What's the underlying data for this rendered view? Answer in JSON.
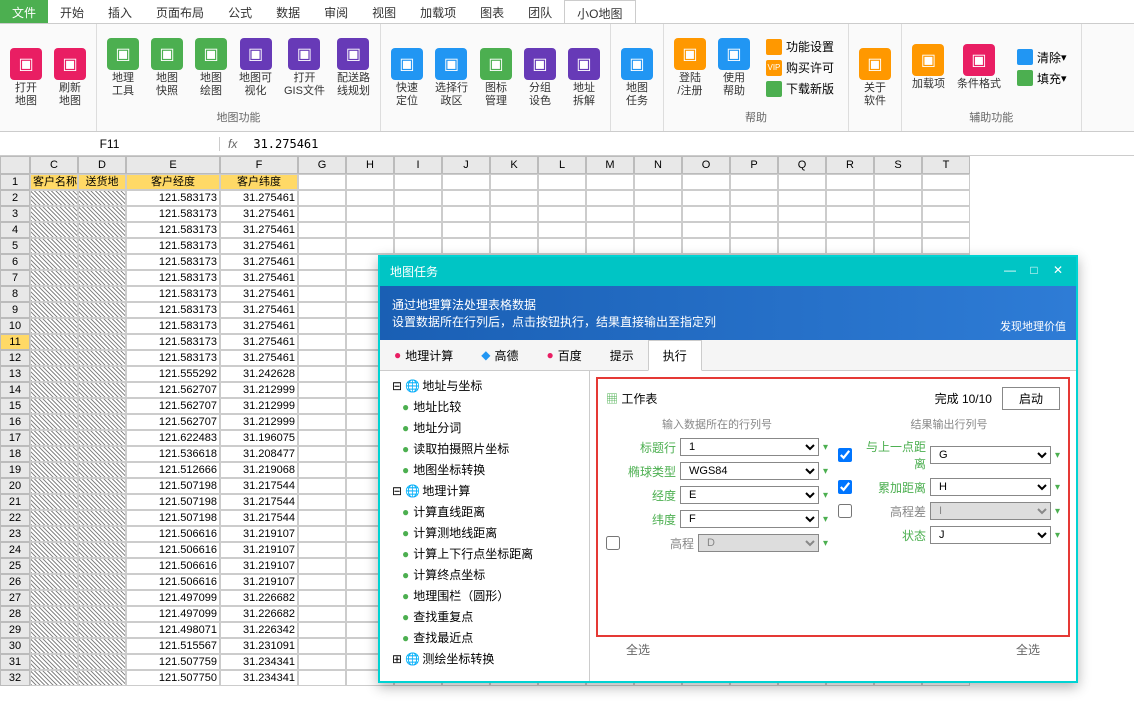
{
  "menu": {
    "file": "文件",
    "tabs": [
      "开始",
      "插入",
      "页面布局",
      "公式",
      "数据",
      "审阅",
      "视图",
      "加载项",
      "图表",
      "团队",
      "小O地图"
    ]
  },
  "ribbon": {
    "group1": {
      "buttons": [
        {
          "label": "打开\n地图",
          "color": "#e91e63"
        },
        {
          "label": "刷新\n地图",
          "color": "#e91e63"
        }
      ]
    },
    "group2": {
      "title": "地图功能",
      "buttons": [
        {
          "label": "地理\n工具",
          "color": "#4CAF50"
        },
        {
          "label": "地图\n快照",
          "color": "#4CAF50"
        },
        {
          "label": "地图\n绘图",
          "color": "#4CAF50"
        },
        {
          "label": "地图可\n视化",
          "color": "#673AB7"
        },
        {
          "label": "打开\nGIS文件",
          "color": "#673AB7"
        },
        {
          "label": "配送路\n线规划",
          "color": "#673AB7"
        }
      ]
    },
    "group3": {
      "buttons": [
        {
          "label": "快速\n定位",
          "color": "#2196F3"
        },
        {
          "label": "选择行\n政区",
          "color": "#2196F3"
        },
        {
          "label": "图标\n管理",
          "color": "#4CAF50"
        },
        {
          "label": "分组\n设色",
          "color": "#673AB7"
        },
        {
          "label": "地址\n拆解",
          "color": "#673AB7"
        }
      ]
    },
    "group4": {
      "buttons": [
        {
          "label": "地图\n任务",
          "color": "#2196F3"
        }
      ]
    },
    "group5": {
      "title": "帮助",
      "buttons": [
        {
          "label": "登陆\n/注册",
          "color": "#ff9800"
        },
        {
          "label": "使用\n帮助",
          "color": "#2196F3"
        }
      ],
      "small": [
        "功能设置",
        "购买许可",
        "下载新版"
      ]
    },
    "group6": {
      "buttons": [
        {
          "label": "关于\n软件",
          "color": "#ff9800"
        }
      ]
    },
    "group7": {
      "title": "辅助功能",
      "buttons": [
        {
          "label": "加载项",
          "color": "#ff9800"
        },
        {
          "label": "条件格式",
          "color": "#e91e63"
        }
      ],
      "small": [
        "清除",
        "填充"
      ]
    }
  },
  "formula": {
    "cell_ref": "F11",
    "fx": "fx",
    "value": "31.275461"
  },
  "sheet": {
    "cols": [
      "C",
      "D",
      "E",
      "F",
      "G",
      "H",
      "I",
      "J",
      "K",
      "L",
      "M",
      "N",
      "O",
      "P",
      "Q",
      "R",
      "S",
      "T"
    ],
    "headers": [
      "客户名称",
      "送货地",
      "客户经度",
      "客户纬度"
    ],
    "selected_row": 11,
    "rows": [
      {
        "n": 1,
        "e": "",
        "f": "",
        "hdr": true
      },
      {
        "n": 2,
        "e": "121.583173",
        "f": "31.275461"
      },
      {
        "n": 3,
        "e": "121.583173",
        "f": "31.275461"
      },
      {
        "n": 4,
        "e": "121.583173",
        "f": "31.275461"
      },
      {
        "n": 5,
        "e": "121.583173",
        "f": "31.275461"
      },
      {
        "n": 6,
        "e": "121.583173",
        "f": "31.275461"
      },
      {
        "n": 7,
        "e": "121.583173",
        "f": "31.275461"
      },
      {
        "n": 8,
        "e": "121.583173",
        "f": "31.275461"
      },
      {
        "n": 9,
        "e": "121.583173",
        "f": "31.275461"
      },
      {
        "n": 10,
        "e": "121.583173",
        "f": "31.275461"
      },
      {
        "n": 11,
        "e": "121.583173",
        "f": "31.275461"
      },
      {
        "n": 12,
        "e": "121.583173",
        "f": "31.275461"
      },
      {
        "n": 13,
        "e": "121.555292",
        "f": "31.242628"
      },
      {
        "n": 14,
        "e": "121.562707",
        "f": "31.212999"
      },
      {
        "n": 15,
        "e": "121.562707",
        "f": "31.212999"
      },
      {
        "n": 16,
        "e": "121.562707",
        "f": "31.212999"
      },
      {
        "n": 17,
        "e": "121.622483",
        "f": "31.196075"
      },
      {
        "n": 18,
        "e": "121.536618",
        "f": "31.208477"
      },
      {
        "n": 19,
        "e": "121.512666",
        "f": "31.219068"
      },
      {
        "n": 20,
        "e": "121.507198",
        "f": "31.217544"
      },
      {
        "n": 21,
        "e": "121.507198",
        "f": "31.217544"
      },
      {
        "n": 22,
        "e": "121.507198",
        "f": "31.217544"
      },
      {
        "n": 23,
        "e": "121.506616",
        "f": "31.219107"
      },
      {
        "n": 24,
        "e": "121.506616",
        "f": "31.219107"
      },
      {
        "n": 25,
        "e": "121.506616",
        "f": "31.219107"
      },
      {
        "n": 26,
        "e": "121.506616",
        "f": "31.219107"
      },
      {
        "n": 27,
        "e": "121.497099",
        "f": "31.226682"
      },
      {
        "n": 28,
        "e": "121.497099",
        "f": "31.226682"
      },
      {
        "n": 29,
        "e": "121.498071",
        "f": "31.226342"
      },
      {
        "n": 30,
        "e": "121.515567",
        "f": "31.231091"
      },
      {
        "n": 31,
        "e": "121.507759",
        "f": "31.234341"
      },
      {
        "n": 32,
        "e": "121.507750",
        "f": "31.234341"
      }
    ]
  },
  "dialog": {
    "title": "地图任务",
    "banner_l1": "通过地理算法处理表格数据",
    "banner_l2": "设置数据所在行列后，点击按钮执行，结果直接输出至指定列",
    "banner_tag": "发现地理价值",
    "tabs": [
      "地理计算",
      "高德",
      "百度",
      "提示",
      "执行"
    ],
    "active_tab": 4,
    "tree": {
      "n1": "地址与坐标",
      "n1c": [
        "地址比较",
        "地址分词",
        "读取拍摄照片坐标",
        "地图坐标转换"
      ],
      "n2": "地理计算",
      "n2c": [
        "计算直线距离",
        "计算测地线距离",
        "计算上下行点坐标距离",
        "计算终点坐标",
        "地理围栏（圆形）",
        "查找重复点",
        "查找最近点"
      ],
      "n3": "测绘坐标转换"
    },
    "form": {
      "worksheet_label": "工作表",
      "progress": "完成 10/10",
      "start": "启动",
      "col1_title": "输入数据所在的行列号",
      "col2_title": "结果输出行列号",
      "rows_left": [
        {
          "label": "标题行",
          "val": "1"
        },
        {
          "label": "椭球类型",
          "val": "WGS84"
        },
        {
          "label": "经度",
          "val": "E"
        },
        {
          "label": "纬度",
          "val": "F"
        },
        {
          "label": "高程",
          "val": "D",
          "disabled": true
        }
      ],
      "rows_right": [
        {
          "label": "与上一点距离",
          "val": "G",
          "chk": true
        },
        {
          "label": "累加距离",
          "val": "H",
          "chk": true
        },
        {
          "label": "高程差",
          "val": "I",
          "chk": false,
          "disabled": true
        },
        {
          "label": "状态",
          "val": "J"
        }
      ],
      "footer": "全选"
    }
  }
}
